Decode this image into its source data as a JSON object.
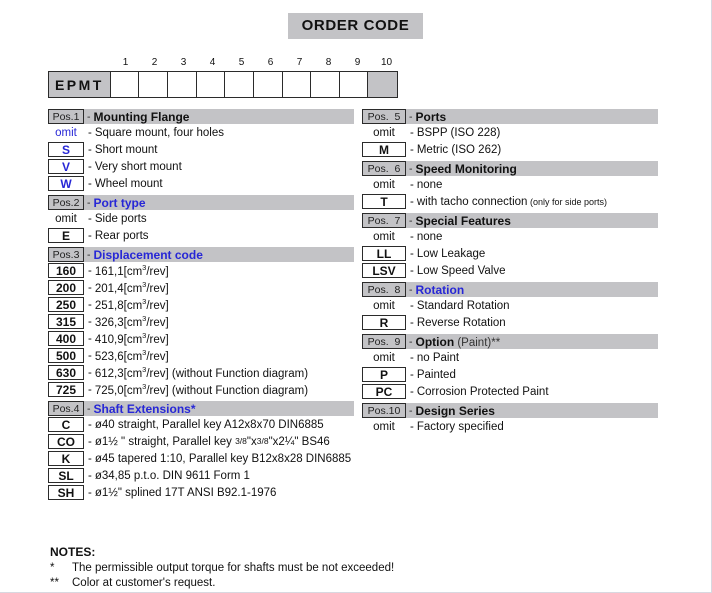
{
  "title": "ORDER CODE",
  "order_code": {
    "prefix": "EPMT",
    "cell_numbers": [
      "1",
      "2",
      "3",
      "4",
      "5",
      "6",
      "7",
      "8",
      "9",
      "10"
    ]
  },
  "colors": {
    "accent_blue": "#2727d6",
    "header_gray": "#c3c3c6",
    "border_dark": "#2b2b2b"
  },
  "left_column": [
    {
      "pos": "Pos.1",
      "title": "Mounting Flange",
      "title_blue": false,
      "options": [
        {
          "code": "omit",
          "boxed": false,
          "blue": true,
          "text": "Square mount, four holes"
        },
        {
          "code": "S",
          "boxed": true,
          "blue": true,
          "text": "Short mount"
        },
        {
          "code": "V",
          "boxed": true,
          "blue": true,
          "text": "Very short  mount"
        },
        {
          "code": "W",
          "boxed": true,
          "blue": true,
          "text": "Wheel mount"
        }
      ]
    },
    {
      "pos": "Pos.2",
      "title": "Port type",
      "title_blue": true,
      "options": [
        {
          "code": "omit",
          "boxed": false,
          "blue": false,
          "text": "Side ports"
        },
        {
          "code": "E",
          "boxed": true,
          "blue": false,
          "text": "Rear ports"
        }
      ]
    },
    {
      "pos": "Pos.3",
      "title": "Displacement code",
      "title_blue": true,
      "options": [
        {
          "code": "160",
          "boxed": true,
          "blue": false,
          "text": "161,1[cm³/rev]"
        },
        {
          "code": "200",
          "boxed": true,
          "blue": false,
          "text": "201,4[cm³/rev]"
        },
        {
          "code": "250",
          "boxed": true,
          "blue": false,
          "text": "251,8[cm³/rev]"
        },
        {
          "code": "315",
          "boxed": true,
          "blue": false,
          "text": "326,3[cm³/rev]"
        },
        {
          "code": "400",
          "boxed": true,
          "blue": false,
          "text": "410,9[cm³/rev]"
        },
        {
          "code": "500",
          "boxed": true,
          "blue": false,
          "text": "523,6[cm³/rev]"
        },
        {
          "code": "630",
          "boxed": true,
          "blue": false,
          "text": "612,3[cm³/rev] (without Function diagram)"
        },
        {
          "code": "725",
          "boxed": true,
          "blue": false,
          "text": "725,0[cm³/rev] (without Function diagram)"
        }
      ]
    },
    {
      "pos": "Pos.4",
      "title": "Shaft Extensions*",
      "title_blue": true,
      "options": [
        {
          "code": "C",
          "boxed": true,
          "blue": false,
          "text": "ø40 straight, Parallel key A12x8x70 DIN6885"
        },
        {
          "code": "CO",
          "boxed": true,
          "blue": false,
          "text": "ø1½ \" straight, Parallel key 3/8\"x3/8\"x2¼\" BS46"
        },
        {
          "code": "K",
          "boxed": true,
          "blue": false,
          "text": "ø45 tapered 1:10, Parallel key B12x8x28 DIN6885"
        },
        {
          "code": "SL",
          "boxed": true,
          "blue": false,
          "text": "ø34,85 p.t.o.  DIN 9611 Form 1"
        },
        {
          "code": "SH",
          "boxed": true,
          "blue": false,
          "text": "ø1½\" splined 17T ANSI B92.1-1976"
        }
      ]
    }
  ],
  "right_column": [
    {
      "pos": "Pos.  5",
      "title": "Ports",
      "title_blue": false,
      "options": [
        {
          "code": "omit",
          "boxed": false,
          "blue": false,
          "text": "BSPP   (ISO 228)"
        },
        {
          "code": "M",
          "boxed": true,
          "blue": false,
          "text": "Metric (ISO 262)"
        }
      ]
    },
    {
      "pos": "Pos.  6",
      "title": "Speed Monitoring",
      "title_blue": false,
      "options": [
        {
          "code": "omit",
          "boxed": false,
          "blue": false,
          "text": "none"
        },
        {
          "code": "T",
          "boxed": true,
          "blue": false,
          "text": "with tacho connection",
          "small_text": "(only for side ports)"
        }
      ]
    },
    {
      "pos": "Pos.  7",
      "title": "Special Features",
      "title_blue": false,
      "options": [
        {
          "code": "omit",
          "boxed": false,
          "blue": false,
          "text": "none"
        },
        {
          "code": "LL",
          "boxed": true,
          "blue": false,
          "text": "Low Leakage"
        },
        {
          "code": "LSV",
          "boxed": true,
          "blue": false,
          "text": "Low Speed Valve"
        }
      ]
    },
    {
      "pos": "Pos.  8",
      "title": "Rotation",
      "title_blue": true,
      "options": [
        {
          "code": "omit",
          "boxed": false,
          "blue": false,
          "text": "Standard Rotation"
        },
        {
          "code": "R",
          "boxed": true,
          "blue": false,
          "text": "Reverse Rotation"
        }
      ]
    },
    {
      "pos": "Pos.  9",
      "title": "Option",
      "title_sub": " (Paint)**",
      "title_blue": false,
      "options": [
        {
          "code": "omit",
          "boxed": false,
          "blue": false,
          "text": "no Paint"
        },
        {
          "code": "P",
          "boxed": true,
          "blue": false,
          "text": "Painted"
        },
        {
          "code": "PC",
          "boxed": true,
          "blue": false,
          "text": "Corrosion Protected Paint"
        }
      ]
    },
    {
      "pos": "Pos.10",
      "title": "Design Series",
      "title_blue": false,
      "options": [
        {
          "code": "omit",
          "boxed": false,
          "blue": false,
          "text": "Factory specified"
        }
      ]
    }
  ],
  "notes": {
    "heading": "NOTES:",
    "items": [
      {
        "mark": "*",
        "text": "The permissible output torque for shafts must be not exceeded!"
      },
      {
        "mark": "**",
        "text": "Color at customer's request."
      }
    ]
  }
}
